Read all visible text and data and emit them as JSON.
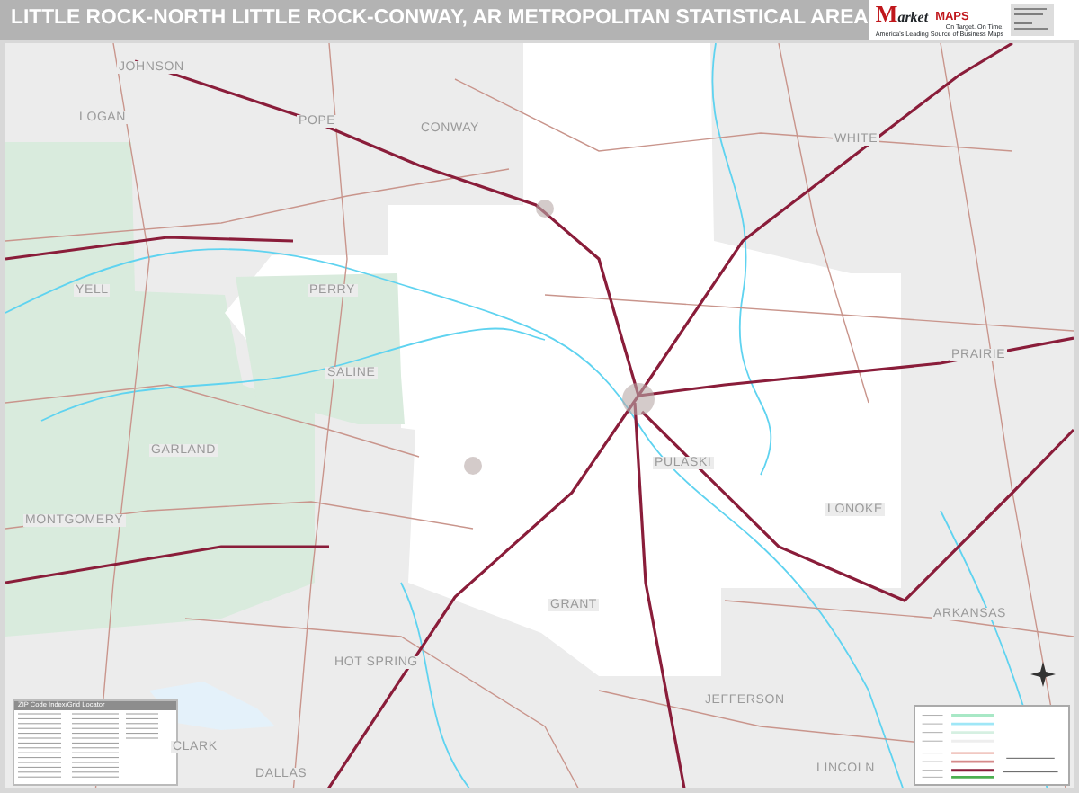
{
  "title": "LITTLE ROCK-NORTH LITTLE ROCK-CONWAY, AR METROPOLITAN STATISTICAL AREA",
  "logo": {
    "initial": "M",
    "word": "arket",
    "maps": "MAPS",
    "slogan": "On Target. On Time.",
    "tagline": "America's Leading Source of Business Maps"
  },
  "map": {
    "counties": [
      {
        "name": "JOHNSON"
      },
      {
        "name": "LOGAN"
      },
      {
        "name": "POPE"
      },
      {
        "name": "CONWAY"
      },
      {
        "name": "WHITE"
      },
      {
        "name": "YELL"
      },
      {
        "name": "PERRY"
      },
      {
        "name": "SALINE"
      },
      {
        "name": "PRAIRIE"
      },
      {
        "name": "PULASKI"
      },
      {
        "name": "GARLAND"
      },
      {
        "name": "LONOKE"
      },
      {
        "name": "MONTGOMERY"
      },
      {
        "name": "GRANT"
      },
      {
        "name": "ARKANSAS"
      },
      {
        "name": "HOT SPRING"
      },
      {
        "name": "JEFFERSON"
      },
      {
        "name": "CLARK"
      },
      {
        "name": "DALLAS"
      },
      {
        "name": "LINCOLN"
      }
    ],
    "zip_index": {
      "title": "ZIP Code Index/Grid Locator"
    }
  }
}
